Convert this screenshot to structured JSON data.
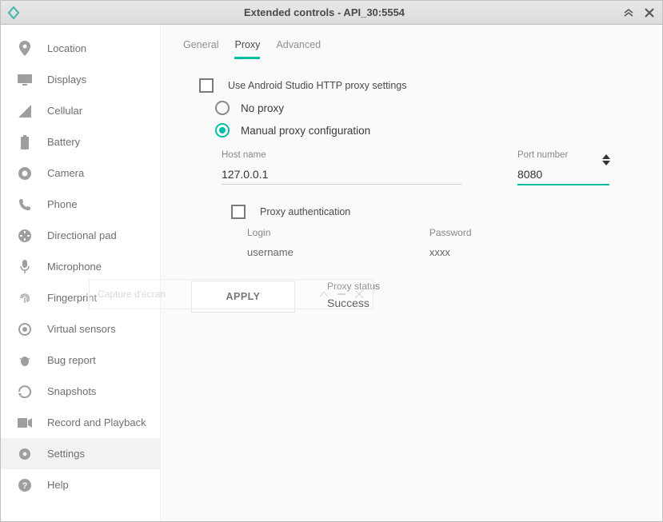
{
  "titlebar": {
    "title": "Extended controls - API_30:5554"
  },
  "sidebar": {
    "items": [
      {
        "label": "Location"
      },
      {
        "label": "Displays"
      },
      {
        "label": "Cellular"
      },
      {
        "label": "Battery"
      },
      {
        "label": "Camera"
      },
      {
        "label": "Phone"
      },
      {
        "label": "Directional pad"
      },
      {
        "label": "Microphone"
      },
      {
        "label": "Fingerprint"
      },
      {
        "label": "Virtual sensors"
      },
      {
        "label": "Bug report"
      },
      {
        "label": "Snapshots"
      },
      {
        "label": "Record and Playback"
      },
      {
        "label": "Settings"
      },
      {
        "label": "Help"
      }
    ]
  },
  "tabs": {
    "general": "General",
    "proxy": "Proxy",
    "advanced": "Advanced"
  },
  "proxy": {
    "use_android_studio": "Use Android Studio HTTP proxy settings",
    "no_proxy": "No proxy",
    "manual": "Manual proxy configuration",
    "host_label": "Host name",
    "host_value": "127.0.0.1",
    "port_label": "Port number",
    "port_value": "8080",
    "auth_label": "Proxy authentication",
    "login_label": "Login",
    "login_value": "username",
    "password_label": "Password",
    "password_value": "xxxx",
    "apply": "APPLY",
    "status_label": "Proxy status",
    "status_value": "Success"
  },
  "ghost": {
    "title": "Capture d'écran"
  }
}
